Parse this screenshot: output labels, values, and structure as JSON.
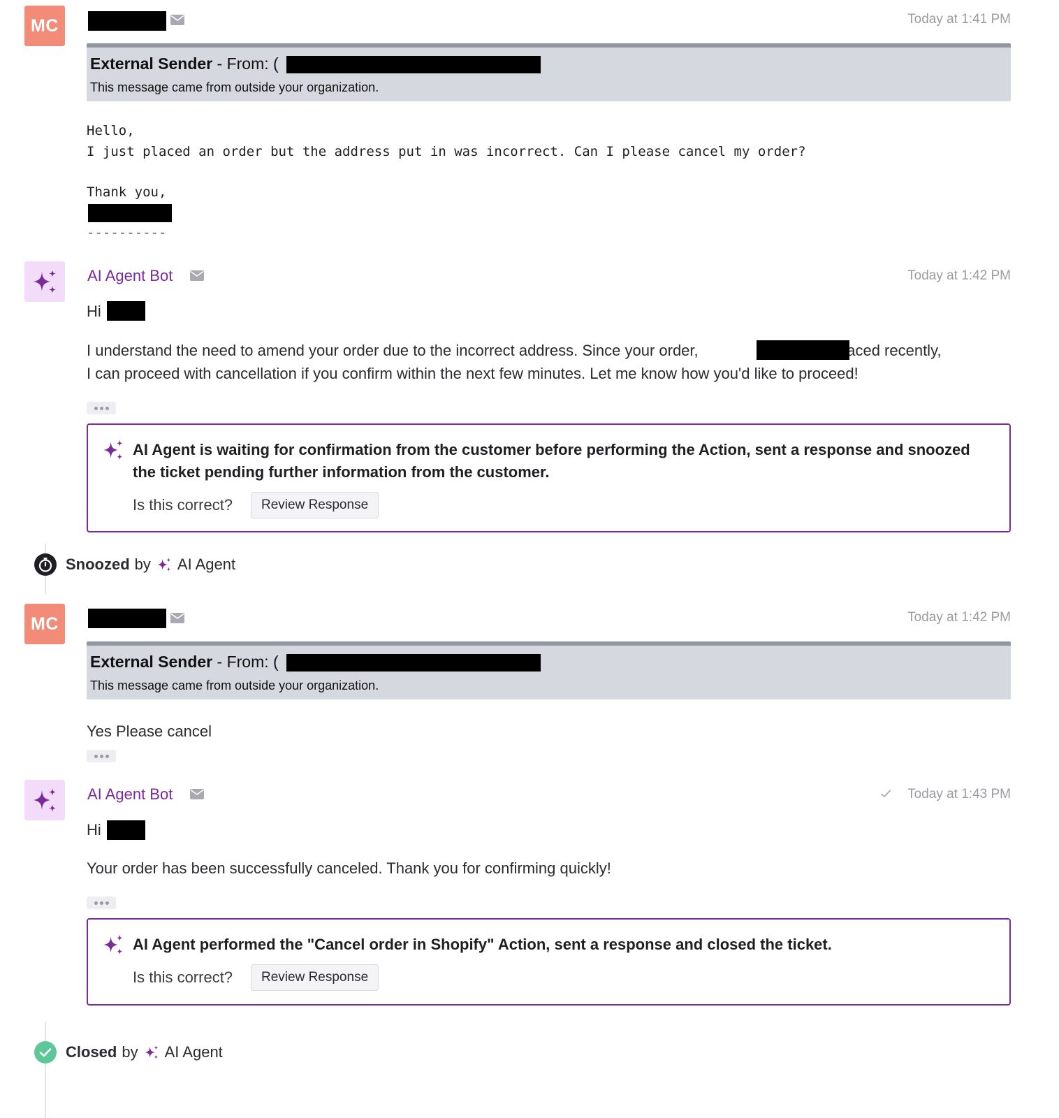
{
  "messages": [
    {
      "avatar_initials": "MC",
      "timestamp": "Today at 1:41 PM",
      "external": {
        "title_bold": "External Sender",
        "title_rest": " - From: (",
        "close_paren": ")",
        "subtitle": "This message came from outside your organization."
      },
      "lines": [
        "Hello,",
        "I just placed an order but the address put in was incorrect. Can I please cancel my order?",
        "Thank you,",
        "----------"
      ]
    },
    {
      "sender": "AI Agent Bot",
      "timestamp": "Today at 1:42 PM",
      "greeting": "Hi",
      "body_line1_before": "I understand the need to amend your order due to the incorrect address. Since your order,",
      "body_line1_after": ", was placed recently,",
      "body_line2": "I can proceed with cancellation if you confirm within the next few minutes. Let me know how you'd like to proceed!",
      "action": {
        "line1": "AI Agent is waiting for confirmation from the customer before performing the Action, sent a response and snoozed",
        "line2": "the ticket pending further information from the customer.",
        "question": "Is this correct?",
        "button": "Review Response"
      }
    },
    {
      "avatar_initials": "MC",
      "timestamp": "Today at 1:42 PM",
      "external": {
        "title_bold": "External Sender",
        "title_rest": " - From: (",
        "close_paren": ")",
        "subtitle": "This message came from outside your organization."
      },
      "body": "Yes Please cancel"
    },
    {
      "sender": "AI Agent Bot",
      "timestamp": "Today at 1:43 PM",
      "greeting": "Hi",
      "body": "Your order has been successfully canceled. Thank you for confirming quickly!",
      "action": {
        "line1": "AI Agent performed the \"Cancel order in Shopify\" Action, sent a response and closed the ticket.",
        "question": "Is this correct?",
        "button": "Review Response"
      }
    }
  ],
  "events": [
    {
      "status": "Snoozed",
      "by": "by",
      "actor": "AI Agent"
    },
    {
      "status": "Closed",
      "by": "by",
      "actor": "AI Agent"
    }
  ],
  "colors": {
    "accent": "#7b2a9a",
    "avatar_customer": "#f28b78",
    "avatar_ai": "#f3dcf9",
    "closed_green": "#5cc89a",
    "external_banner": "#d6d8df"
  }
}
